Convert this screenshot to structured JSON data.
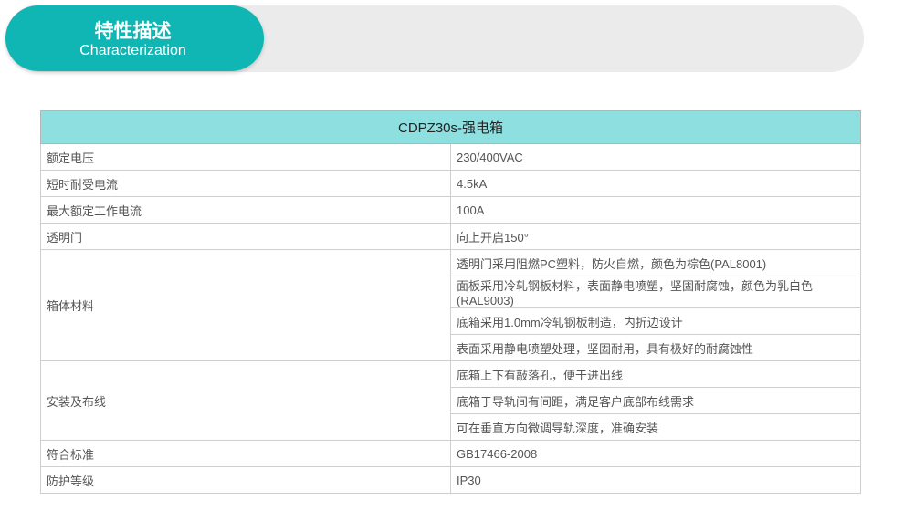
{
  "banner": {
    "title": "特性描述",
    "subtitle": "Characterization"
  },
  "table": {
    "title": "CDPZ30s-强电箱",
    "rows": [
      {
        "label": "额定电压",
        "values": [
          "230/400VAC"
        ]
      },
      {
        "label": "短时耐受电流",
        "values": [
          "4.5kA"
        ]
      },
      {
        "label": "最大额定工作电流",
        "values": [
          "100A"
        ]
      },
      {
        "label": "透明门",
        "values": [
          "向上开启150°"
        ]
      },
      {
        "label": "箱体材料",
        "values": [
          "透明门采用阻燃PC塑料，防火自燃，颜色为棕色(PAL8001)",
          "面板采用冷轧钢板材料，表面静电喷塑，坚固耐腐蚀，颜色为乳白色(RAL9003)",
          "底箱采用1.0mm冷轧钢板制造，内折边设计",
          "表面采用静电喷塑处理，坚固耐用，具有极好的耐腐蚀性"
        ]
      },
      {
        "label": "安装及布线",
        "values": [
          "底箱上下有敲落孔，便于进出线",
          "底箱于导轨间有间距，满足客户底部布线需求",
          "可在垂直方向微调导轨深度，准确安装"
        ]
      },
      {
        "label": "符合标准",
        "values": [
          "GB17466-2008"
        ]
      },
      {
        "label": "防护等级",
        "values": [
          "IP30"
        ]
      }
    ]
  },
  "colors": {
    "accent": "#10b6b4",
    "header_bg": "#8edfdf",
    "banner_bg": "#ebebeb"
  }
}
